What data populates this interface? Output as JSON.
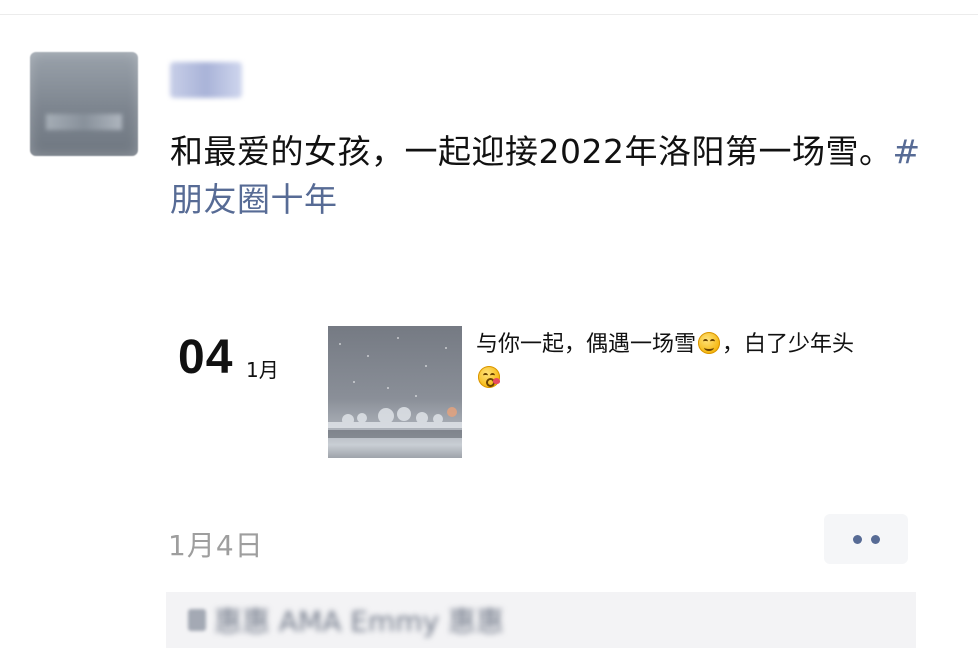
{
  "user": {
    "name": "惠惠"
  },
  "post": {
    "text": "和最爱的女孩，一起迎接2022年洛阳第一场雪。",
    "hashtag": "#朋友圈十年"
  },
  "album_entry": {
    "day": "04",
    "month": "1月",
    "caption_part1": "与你一起，偶遇一场雪",
    "caption_part2": "，白了少年头",
    "emoji_1": "smiling-face-icon",
    "emoji_2": "kissing-face-icon"
  },
  "footer": {
    "date": "1月4日"
  },
  "comments": {
    "blurred_text": "惠惠 AMA Emmy 惠惠"
  },
  "colors": {
    "link": "#576b95",
    "date_gray": "#9e9e9e",
    "panel_bg": "#f3f3f5"
  }
}
